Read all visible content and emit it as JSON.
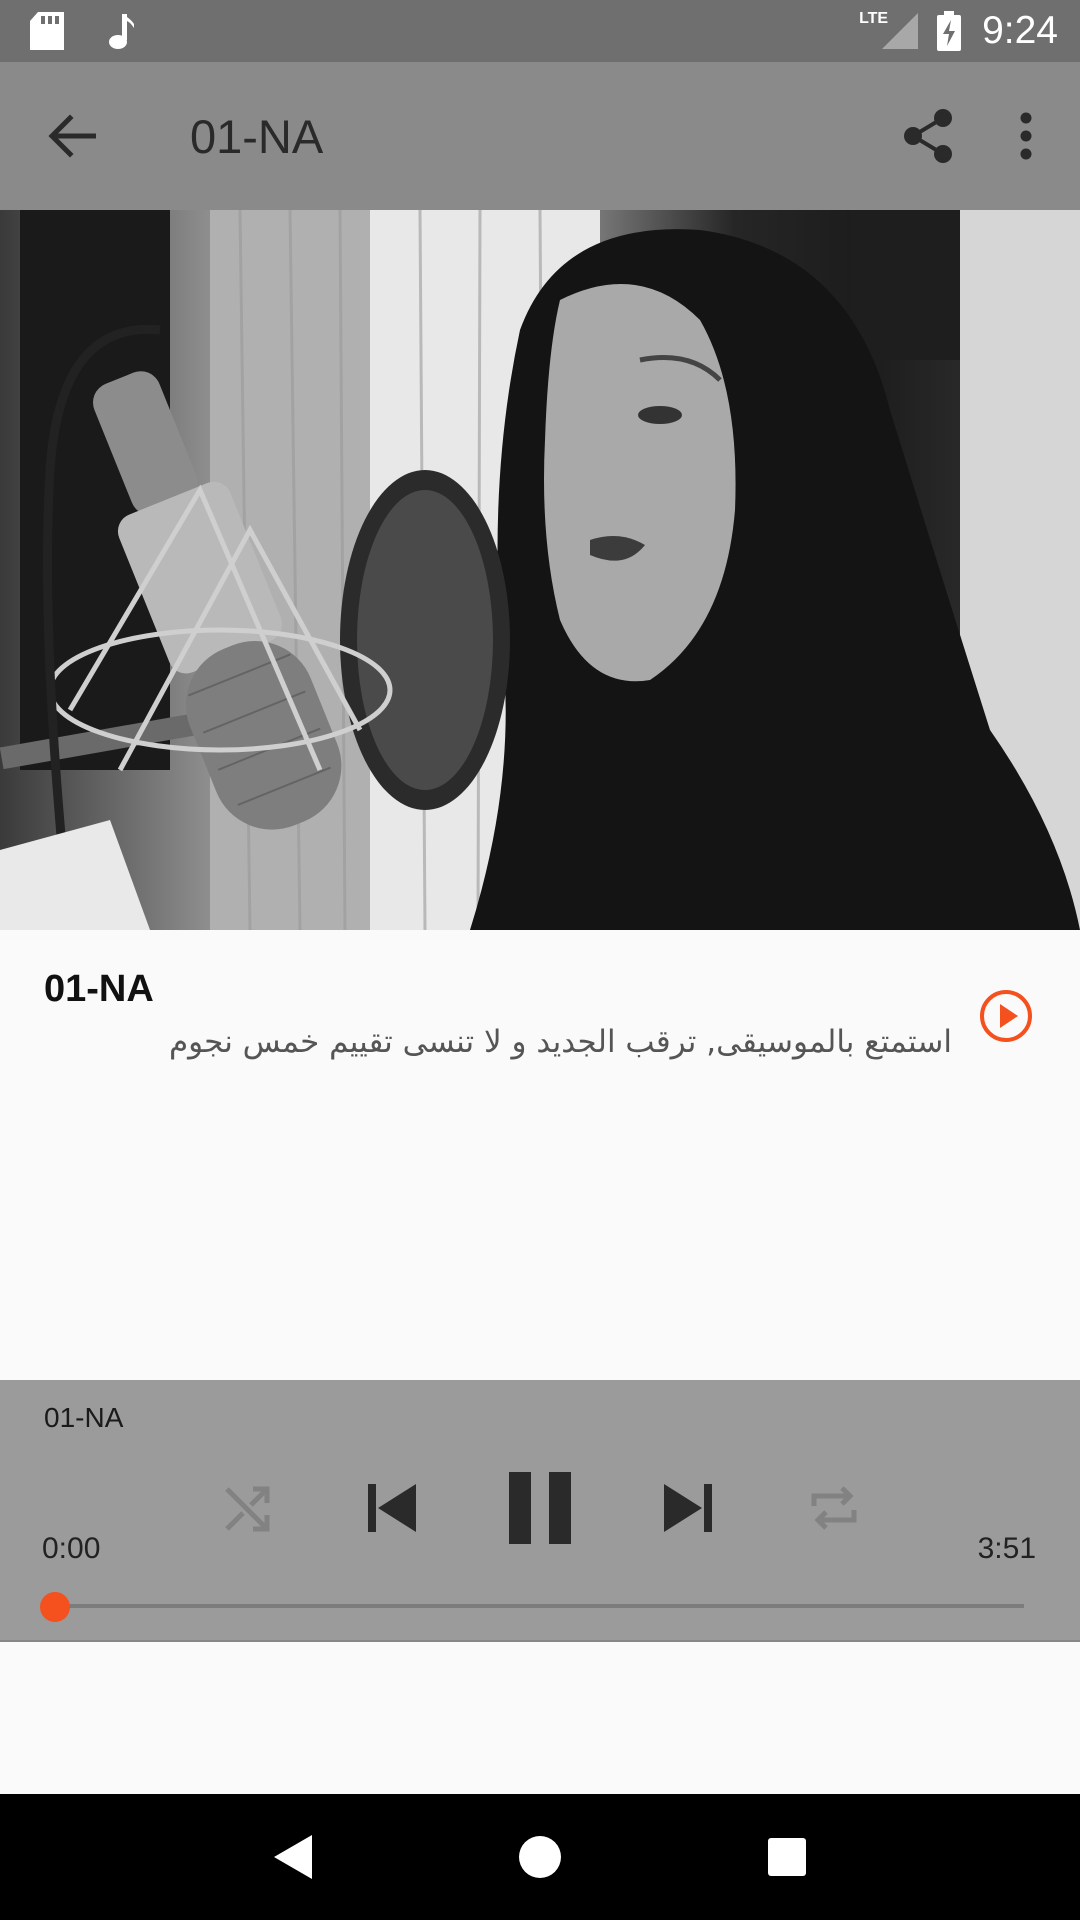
{
  "status_bar": {
    "time": "9:24",
    "network": "LTE",
    "icons": [
      "sd-card-icon",
      "music-note-icon",
      "signal-icon",
      "battery-charging-icon"
    ]
  },
  "toolbar": {
    "title": "01-NA",
    "back_icon": "arrow-back-icon",
    "share_icon": "share-icon",
    "more_icon": "more-vert-icon"
  },
  "track": {
    "title": "01-NA",
    "description": "استمتع بالموسيقى, ترقب الجديد و لا تنسى تقييم خمس نجوم",
    "play_icon": "play-circle-icon"
  },
  "player": {
    "title": "01-NA",
    "elapsed": "0:00",
    "total": "3:51",
    "progress": 0.0,
    "controls": [
      "shuffle-icon",
      "skip-previous-icon",
      "pause-icon",
      "skip-next-icon",
      "repeat-icon"
    ]
  },
  "colors": {
    "accent": "#f4511e",
    "toolbar": "#8a8a8a",
    "status_bar": "#6f6f6f",
    "player": "#9b9b9b"
  }
}
